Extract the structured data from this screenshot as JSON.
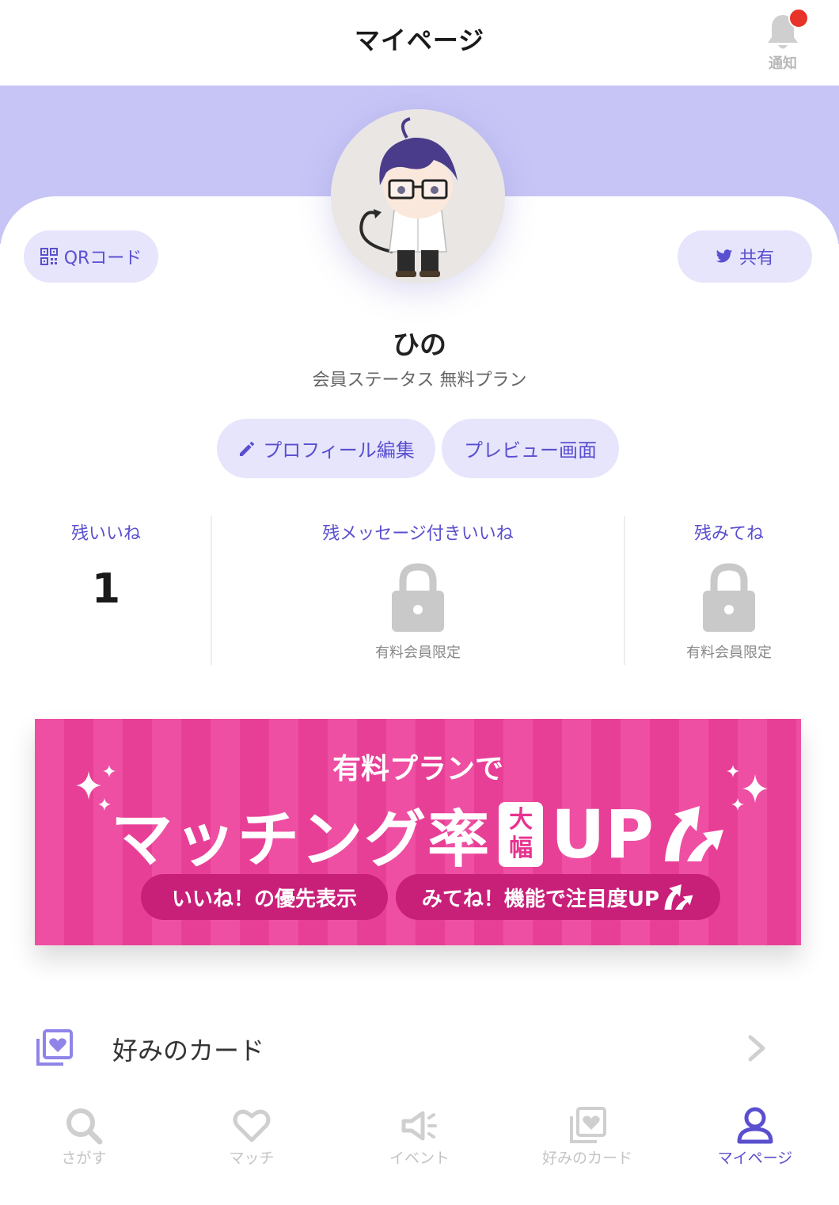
{
  "header": {
    "title": "マイページ",
    "notification_label": "通知"
  },
  "profile": {
    "qr_label": "QRコード",
    "share_label": "共有",
    "name": "ひの",
    "status": "会員ステータス 無料プラン",
    "edit_label": "プロフィール編集",
    "preview_label": "プレビュー画面"
  },
  "stats": [
    {
      "label": "残いいね",
      "value": "1"
    },
    {
      "label": "残メッセージ付きいいね",
      "sub": "有料会員限定"
    },
    {
      "label": "残みてね",
      "sub": "有料会員限定"
    }
  ],
  "promo": {
    "subtitle": "有料プランで",
    "main_text": "マッチング率",
    "badge_top": "大",
    "badge_bottom": "幅",
    "up_text": "UP",
    "chip1": "いいね！の優先表示",
    "chip2": "みてね！機能で注目度UP"
  },
  "list": {
    "favorite_cards_label": "好みのカード"
  },
  "nav": {
    "items": [
      {
        "label": "さがす",
        "icon": "search-icon"
      },
      {
        "label": "マッチ",
        "icon": "heart-icon"
      },
      {
        "label": "イベント",
        "icon": "megaphone-icon"
      },
      {
        "label": "好みのカード",
        "icon": "cards-icon"
      },
      {
        "label": "マイページ",
        "icon": "user-icon"
      }
    ],
    "active_index": 4
  },
  "colors": {
    "accent": "#5a4fcf",
    "banner": "#c7c5f6",
    "promo_pink": "#ee4fa3",
    "notification_dot": "#e8332a"
  }
}
